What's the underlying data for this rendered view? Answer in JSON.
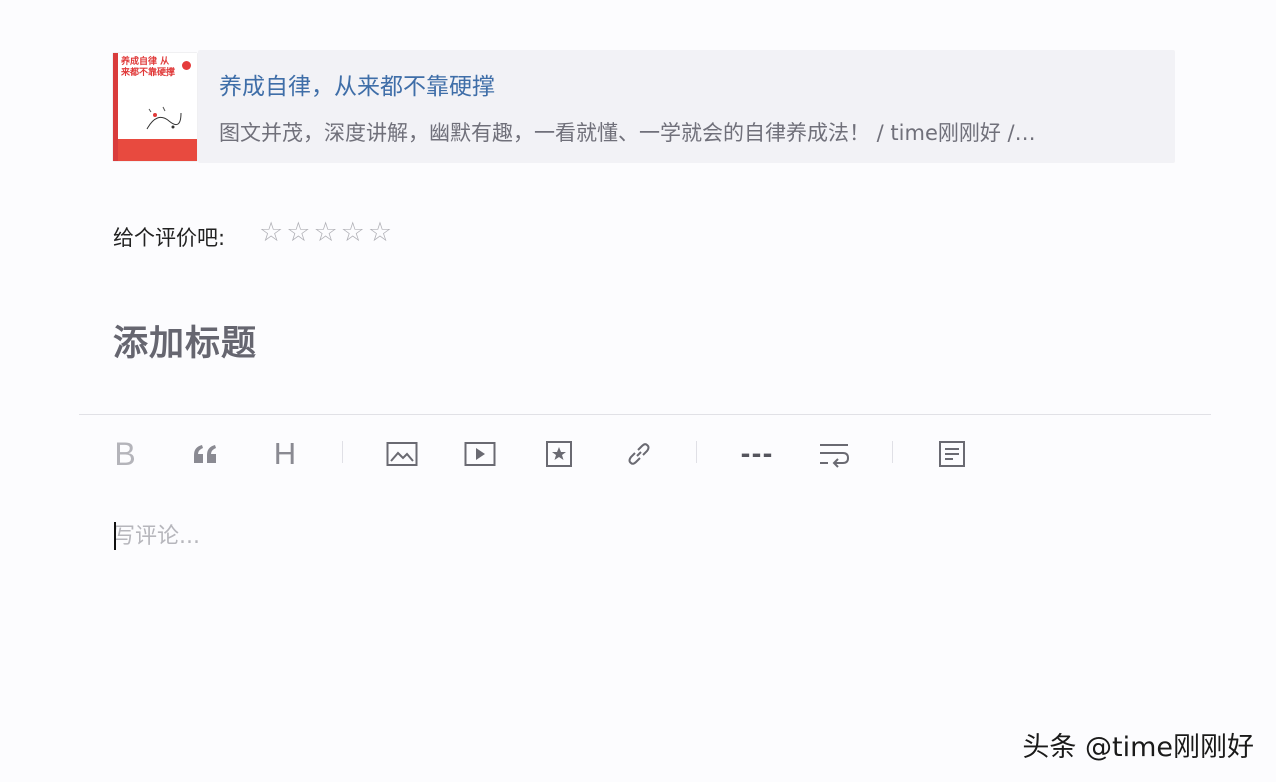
{
  "book": {
    "cover_title": "养成自律 从来都不靠硬撑",
    "title": "养成自律，从来都不靠硬撑",
    "description": "图文并茂，深度讲解，幽默有趣，一看就懂、一学就会的自律养成法！ / time刚刚好 /…"
  },
  "rating": {
    "label": "给个评价吧:",
    "stars": [
      "☆",
      "☆",
      "☆",
      "☆",
      "☆"
    ],
    "value": 0,
    "max": 5
  },
  "editor": {
    "title_placeholder": "添加标题",
    "comment_placeholder": "写评论..."
  },
  "toolbar": {
    "bold_glyph": "B",
    "heading_glyph": "H",
    "divider_glyph": "---",
    "icons": [
      "bold-icon",
      "quote-icon",
      "heading-icon",
      "image-icon",
      "video-icon",
      "favorite-icon",
      "link-icon",
      "divider-line-icon",
      "wrap-icon",
      "document-icon"
    ]
  },
  "watermark": {
    "text": "头条 @time刚刚好"
  },
  "colors": {
    "link_blue": "#3f6ea8",
    "icon_gray": "#8a8a92",
    "cover_red": "#e03a3a"
  }
}
